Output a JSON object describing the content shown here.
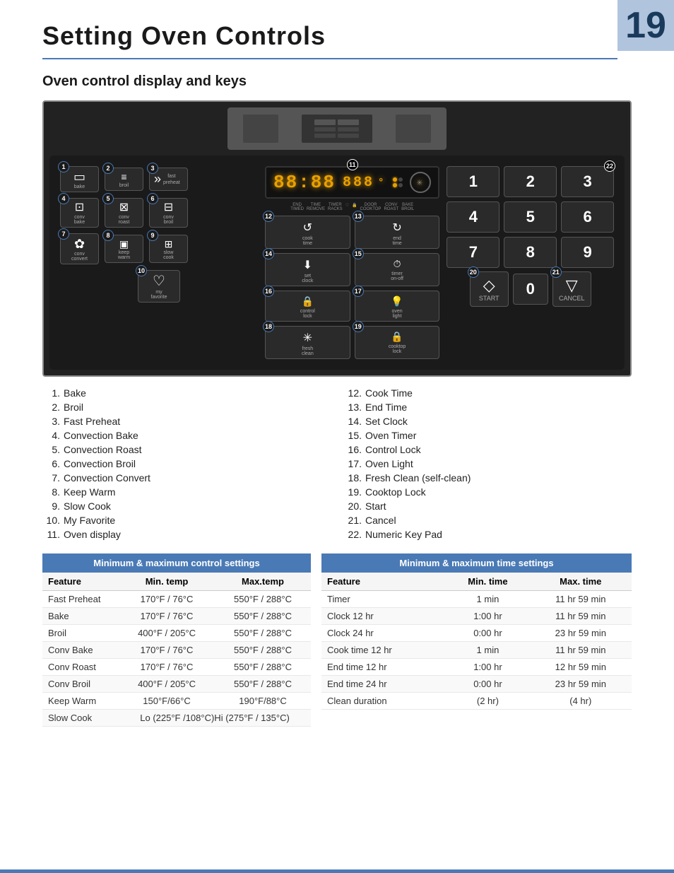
{
  "page": {
    "number": "19",
    "title": "Setting Oven Controls",
    "section_heading": "Oven control display and keys"
  },
  "controls_list_left": [
    {
      "num": "1.",
      "label": "Bake"
    },
    {
      "num": "2.",
      "label": "Broil"
    },
    {
      "num": "3.",
      "label": "Fast Preheat"
    },
    {
      "num": "4.",
      "label": "Convection Bake"
    },
    {
      "num": "5.",
      "label": "Convection Roast"
    },
    {
      "num": "6.",
      "label": "Convection Broil"
    },
    {
      "num": "7.",
      "label": "Convection Convert"
    },
    {
      "num": "8.",
      "label": "Keep Warm"
    },
    {
      "num": "9.",
      "label": "Slow Cook"
    },
    {
      "num": "10.",
      "label": "My Favorite"
    },
    {
      "num": "11.",
      "label": "Oven display"
    }
  ],
  "controls_list_right": [
    {
      "num": "12.",
      "label": "Cook Time"
    },
    {
      "num": "13.",
      "label": "End Time"
    },
    {
      "num": "14.",
      "label": "Set Clock"
    },
    {
      "num": "15.",
      "label": "Oven Timer"
    },
    {
      "num": "16.",
      "label": "Control Lock"
    },
    {
      "num": "17.",
      "label": "Oven Light"
    },
    {
      "num": "18.",
      "label": "Fresh Clean (self-clean)"
    },
    {
      "num": "19.",
      "label": "Cooktop Lock"
    },
    {
      "num": "20.",
      "label": "Start"
    },
    {
      "num": "21.",
      "label": "Cancel"
    },
    {
      "num": "22.",
      "label": "Numeric Key Pad"
    }
  ],
  "table_control": {
    "header": "Minimum & maximum control settings",
    "columns": [
      "Feature",
      "Min. temp",
      "Max.temp"
    ],
    "rows": [
      [
        "Fast Preheat",
        "170°F / 76°C",
        "550°F / 288°C"
      ],
      [
        "Bake",
        "170°F / 76°C",
        "550°F / 288°C"
      ],
      [
        "Broil",
        "400°F / 205°C",
        "550°F / 288°C"
      ],
      [
        "Conv Bake",
        "170°F / 76°C",
        "550°F / 288°C"
      ],
      [
        "Conv Roast",
        "170°F / 76°C",
        "550°F / 288°C"
      ],
      [
        "Conv Broil",
        "400°F / 205°C",
        "550°F / 288°C"
      ],
      [
        "Keep  Warm",
        "150°F/66°C",
        "190°F/88°C"
      ],
      [
        "Slow Cook",
        "Lo (225°F /108°C)",
        "Hi (275°F / 135°C)"
      ]
    ]
  },
  "table_time": {
    "header": "Minimum & maximum time settings",
    "columns": [
      "Feature",
      "Min. time",
      "Max. time"
    ],
    "rows": [
      [
        "Timer",
        "1 min",
        "11 hr 59 min"
      ],
      [
        "Clock 12 hr",
        "1:00 hr",
        "11 hr 59 min"
      ],
      [
        "Clock 24 hr",
        "0:00 hr",
        "23 hr 59 min"
      ],
      [
        "Cook time 12 hr",
        "1 min",
        "11 hr 59 min"
      ],
      [
        "End time 12 hr",
        "1:00 hr",
        "12 hr 59 min"
      ],
      [
        "End time 24 hr",
        "0:00 hr",
        "23 hr 59 min"
      ],
      [
        "Clean duration",
        "(2 hr)",
        "(4 hr)"
      ]
    ]
  },
  "panel": {
    "display_text": "88:88 888",
    "buttons_row1": [
      {
        "num": "1",
        "icon": "▭",
        "label": "bake"
      },
      {
        "num": "2",
        "icon": "≡",
        "label": "broil"
      },
      {
        "num": "3",
        "icon": "»",
        "label": "fast\npreheat"
      }
    ],
    "buttons_row2": [
      {
        "num": "4",
        "icon": "⊡",
        "label": "conv\nbake"
      },
      {
        "num": "5",
        "icon": "⊠",
        "label": "conv\nroast"
      },
      {
        "num": "6",
        "icon": "⊟",
        "label": "conv\nbroil"
      }
    ],
    "buttons_row3": [
      {
        "num": "7",
        "icon": "✿",
        "label": "conv\nconvert"
      },
      {
        "num": "8",
        "icon": "▣",
        "label": "keep\nwarm"
      },
      {
        "num": "9",
        "icon": "⊞",
        "label": "slow\ncook"
      }
    ],
    "button_fav": {
      "num": "10",
      "icon": "♡",
      "label": "my\nfavorite"
    },
    "center_top": [
      {
        "num": "12",
        "icon": "↺",
        "label": "cook\ntime"
      },
      {
        "num": "13",
        "icon": "↻",
        "label": "end\ntime"
      },
      {
        "num": "14",
        "icon": "↓",
        "label": "set\nclock"
      },
      {
        "num": "15",
        "icon": "⏱",
        "label": "timer\non-off"
      }
    ],
    "center_bottom": [
      {
        "num": "16",
        "icon": "🔒",
        "label": "control\nlock"
      },
      {
        "num": "17",
        "icon": "💡",
        "label": "oven\nlight"
      },
      {
        "num": "18",
        "icon": "✳",
        "label": "fresh\nclean"
      },
      {
        "num": "19",
        "icon": "🔒",
        "label": "cooktop\nlock"
      }
    ],
    "numpad": [
      "1",
      "2",
      "3",
      "4",
      "5",
      "6",
      "7",
      "8",
      "9",
      "0"
    ],
    "numpad_num": "22",
    "start_label": "START",
    "start_num": "20",
    "cancel_label": "CANCEL",
    "cancel_num": "21",
    "display_labels": [
      "END\nTIMED",
      "TIME\nREMOVE",
      "TIMER\nRACKS",
      "♡",
      "🔒",
      "DOOR\nCOOKTOP",
      "CONV\nROAST",
      "BAKE\nBROIL"
    ]
  }
}
